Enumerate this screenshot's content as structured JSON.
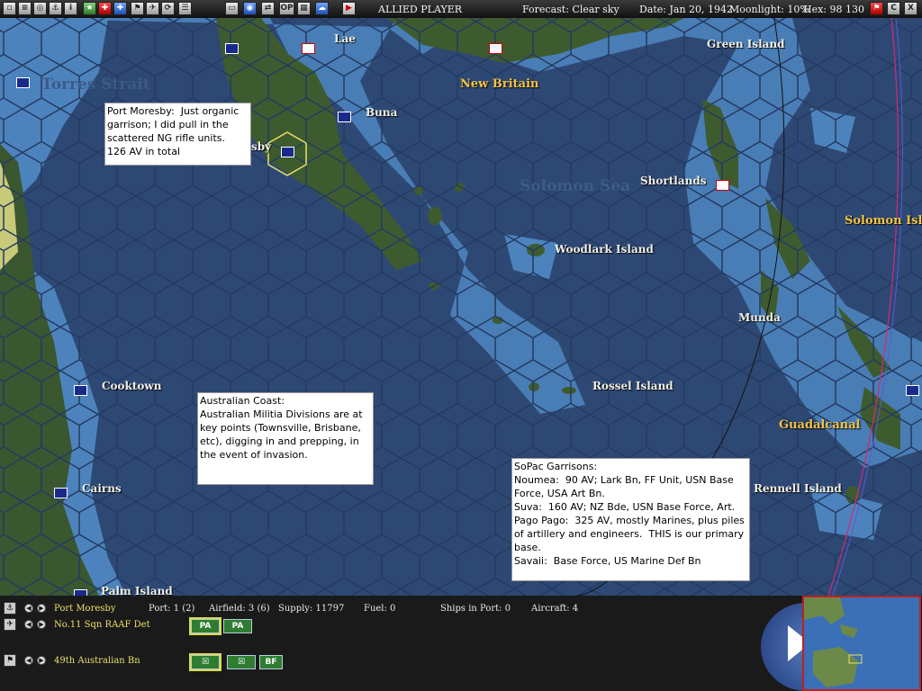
{
  "toolbar": {
    "player": "ALLIED PLAYER",
    "forecast": "Forecast: Clear sky",
    "date": "Date: Jan 20, 1942",
    "moonlight": "Moonlight: 10%",
    "hex": "Hex: 98 130",
    "icons": [
      "window-icon",
      "document-icon",
      "target-icon",
      "ship-icon",
      "info-icon",
      "star-icon",
      "cross-red-icon",
      "cross-blue-icon",
      "flag-icon",
      "aircraft-icon",
      "refresh-icon",
      "list-icon",
      "globe-icon",
      "op-icon",
      "map-toggle-icon",
      "cloud-icon",
      "end-turn-icon"
    ],
    "op_label": "OP",
    "right_buttons": [
      "flag-icon",
      "C",
      "X"
    ]
  },
  "map": {
    "labels": [
      {
        "id": "lae",
        "text": "Lae",
        "style": "normal"
      },
      {
        "id": "green-island",
        "text": "Green Island",
        "style": "normal"
      },
      {
        "id": "torres-strait",
        "text": "Torres Strait",
        "style": "big"
      },
      {
        "id": "new-britain",
        "text": "New Britain",
        "style": "yellow"
      },
      {
        "id": "buna",
        "text": "Buna",
        "style": "normal"
      },
      {
        "id": "port-moresby",
        "text": "sby",
        "style": "normal"
      },
      {
        "id": "solomon-sea",
        "text": "Solomon Sea",
        "style": "big"
      },
      {
        "id": "shortlands",
        "text": "Shortlands",
        "style": "normal"
      },
      {
        "id": "solomon-islands",
        "text": "Solomon Isla",
        "style": "yellow"
      },
      {
        "id": "woodlark-island",
        "text": "Woodlark Island",
        "style": "normal"
      },
      {
        "id": "munda",
        "text": "Munda",
        "style": "normal"
      },
      {
        "id": "cooktown",
        "text": "Cooktown",
        "style": "normal"
      },
      {
        "id": "rossel-island",
        "text": "Rossel Island",
        "style": "normal"
      },
      {
        "id": "guadalcanal",
        "text": "Guadalcanal",
        "style": "yellow"
      },
      {
        "id": "cairns",
        "text": "Cairns",
        "style": "normal"
      },
      {
        "id": "rennell-island",
        "text": "Rennell Island",
        "style": "normal"
      },
      {
        "id": "palm-island",
        "text": "Palm Island",
        "style": "normal"
      }
    ],
    "notes": [
      {
        "id": "port-moresby-note",
        "text": "Port Moresby:  Just organic garrison; I did pull in the scattered NG rifle units.  126 AV in total"
      },
      {
        "id": "australian-coast-note",
        "text": "Australian Coast:\nAustralian Militia Divisions are at key points (Townsville, Brisbane, etc), digging in and prepping, in the event of invasion."
      },
      {
        "id": "sopac-note",
        "text": "SoPac Garrisons:\nNoumea:  90 AV; Lark Bn, FF Unit, USN Base Force, USA Art Bn.\nSuva:  160 AV; NZ Bde, USN Base Force, Art.\nPago Pago:  325 AV, mostly Marines, plus piles of artillery and engineers.  THIS is our primary base.\nSavaii:  Base Force, US Marine Def Bn"
      }
    ]
  },
  "status": {
    "base_name": "Port Moresby",
    "port": "Port: 1 (2)",
    "airfield": "Airfield: 3 (6)",
    "supply": "Supply: 11797",
    "fuel": "Fuel: 0",
    "ships_in_port": "Ships in Port: 0",
    "aircraft": "Aircraft: 4",
    "air_unit": "No.11 Sqn RAAF Det",
    "ground_unit": "49th Australian Bn",
    "air_buttons": [
      "PA",
      "PA"
    ],
    "ground_buttons": [
      "",
      "",
      "BF"
    ]
  },
  "colors": {
    "deep_sea": "#2e4874",
    "shallow": "#4d83bd",
    "land": "#3b5730",
    "label_yellow": "#f3c343"
  }
}
